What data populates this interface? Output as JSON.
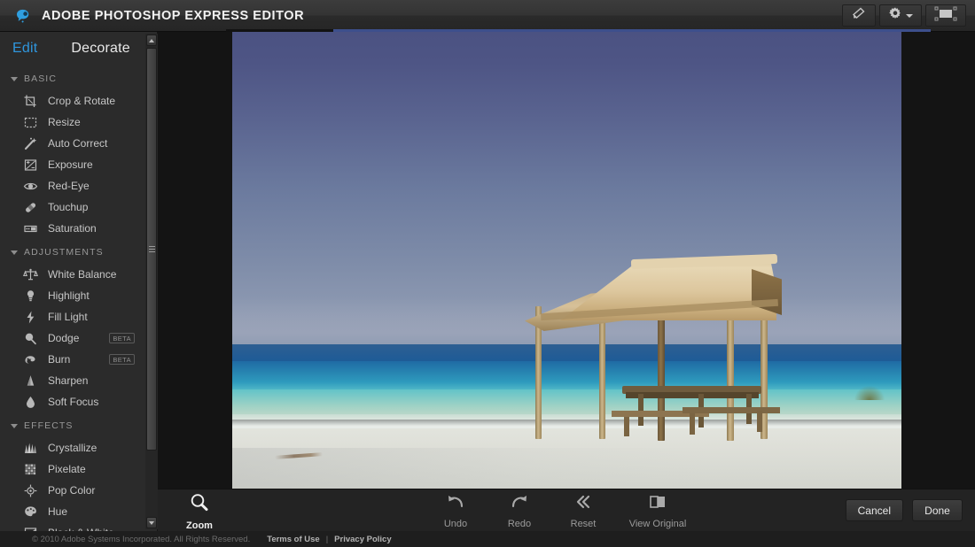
{
  "titlebar": {
    "app_title": "ADOBE PHOTOSHOP EXPRESS EDITOR",
    "logo_icon": "adobe-express-bubble-icon",
    "tools": [
      {
        "name": "feedback-icon",
        "label": ""
      },
      {
        "name": "gear-icon",
        "label": ""
      },
      {
        "name": "fullscreen-icon",
        "label": ""
      }
    ]
  },
  "sidebar": {
    "tabs": [
      {
        "label": "Edit",
        "active": true
      },
      {
        "label": "Decorate",
        "active": false
      }
    ],
    "groups": [
      {
        "title": "BASIC",
        "expanded": true,
        "items": [
          {
            "label": "Crop & Rotate",
            "icon": "crop-icon",
            "badge": ""
          },
          {
            "label": "Resize",
            "icon": "resize-icon",
            "badge": ""
          },
          {
            "label": "Auto Correct",
            "icon": "magic-wand-icon",
            "badge": ""
          },
          {
            "label": "Exposure",
            "icon": "exposure-icon",
            "badge": ""
          },
          {
            "label": "Red-Eye",
            "icon": "eye-icon",
            "badge": ""
          },
          {
            "label": "Touchup",
            "icon": "bandage-icon",
            "badge": ""
          },
          {
            "label": "Saturation",
            "icon": "saturation-icon",
            "badge": ""
          }
        ]
      },
      {
        "title": "ADJUSTMENTS",
        "expanded": true,
        "items": [
          {
            "label": "White Balance",
            "icon": "balance-scale-icon",
            "badge": ""
          },
          {
            "label": "Highlight",
            "icon": "lightbulb-icon",
            "badge": ""
          },
          {
            "label": "Fill Light",
            "icon": "lightning-bolt-icon",
            "badge": ""
          },
          {
            "label": "Dodge",
            "icon": "dodge-icon",
            "badge": "BETA"
          },
          {
            "label": "Burn",
            "icon": "burn-icon",
            "badge": "BETA"
          },
          {
            "label": "Sharpen",
            "icon": "sharpen-icon",
            "badge": ""
          },
          {
            "label": "Soft Focus",
            "icon": "droplet-icon",
            "badge": ""
          }
        ]
      },
      {
        "title": "EFFECTS",
        "expanded": true,
        "items": [
          {
            "label": "Crystallize",
            "icon": "crystallize-icon",
            "badge": ""
          },
          {
            "label": "Pixelate",
            "icon": "pixelate-icon",
            "badge": ""
          },
          {
            "label": "Pop Color",
            "icon": "pop-color-icon",
            "badge": ""
          },
          {
            "label": "Hue",
            "icon": "palette-icon",
            "badge": ""
          },
          {
            "label": "Black & White",
            "icon": "black-white-icon",
            "badge": ""
          }
        ]
      }
    ]
  },
  "canvas": {
    "photo_description": "Beach scene with thatched palapa hut, picnic table, turquoise sea and blue sky"
  },
  "bottombar": {
    "zoom_tool": {
      "label": "Zoom",
      "icon": "magnifier-icon",
      "active": true
    },
    "history": [
      {
        "label": "Undo",
        "icon": "undo-arrow-icon"
      },
      {
        "label": "Redo",
        "icon": "redo-arrow-icon"
      },
      {
        "label": "Reset",
        "icon": "double-chevron-left-icon"
      },
      {
        "label": "View Original",
        "icon": "split-view-icon"
      }
    ],
    "actions": [
      {
        "label": "Cancel",
        "name": "cancel-button"
      },
      {
        "label": "Done",
        "name": "done-button"
      }
    ]
  },
  "footer": {
    "copyright": "© 2010 Adobe Systems Incorporated. All Rights Reserved.",
    "terms_label": "Terms of Use",
    "separator": "|",
    "privacy_label": "Privacy Policy"
  },
  "colors": {
    "accent_blue": "#2f96dd",
    "stripe_blue": "#3d4f8c",
    "titlebar": "#343434",
    "sidebar": "#2b2b2b",
    "canvas_bg": "#141414"
  }
}
